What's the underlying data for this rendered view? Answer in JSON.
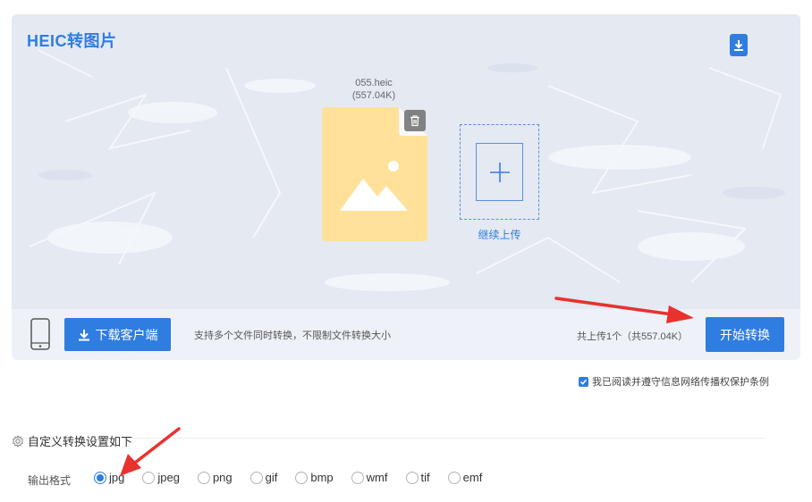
{
  "app": {
    "title": "HEIC转图片"
  },
  "file": {
    "name": "055.heic",
    "size": "(557.04K)"
  },
  "upload": {
    "add_more_label": "继续上传"
  },
  "bottom_bar": {
    "download_client_label": "下载客户端",
    "tip": "支持多个文件同时转换，不限制文件转换大小",
    "summary": "共上传1个（共557.04K）",
    "start_label": "开始转换"
  },
  "agreement": {
    "label": "我已阅读并遵守信息网络传播权保护条例",
    "checked": true
  },
  "settings": {
    "title": "自定义转换设置如下",
    "format_label": "输出格式",
    "formats": [
      "jpg",
      "jpeg",
      "png",
      "gif",
      "bmp",
      "wmf",
      "tif",
      "emf"
    ],
    "selected": "jpg"
  },
  "colors": {
    "accent": "#2f7de1",
    "file_icon": "#ffe19a",
    "annotation_arrow": "#e8322d"
  },
  "icons": [
    "download-icon",
    "trash-icon",
    "image-icon",
    "plus-icon",
    "phone-icon",
    "gear-icon"
  ]
}
